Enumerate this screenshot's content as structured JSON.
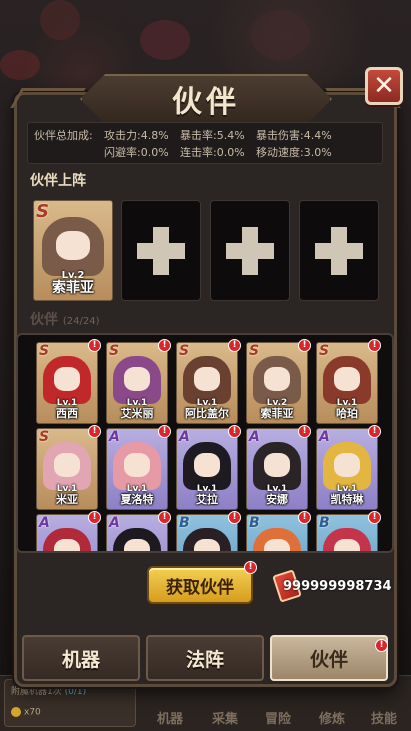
{
  "modal": {
    "title": "伙伴",
    "close_label": "✕"
  },
  "stats": {
    "label": "伙伴总加成:",
    "items": [
      "攻击力:4.8%",
      "暴击率:5.4%",
      "暴击伤害:4.4%",
      "闪避率:0.0%",
      "连击率:0.0%",
      "移动速度:3.0%"
    ]
  },
  "lineup": {
    "title": "伙伴上阵",
    "card": {
      "rarity": "S",
      "level": "Lv.2",
      "name": "索菲亚",
      "color": "#7a5a48"
    }
  },
  "roster": {
    "title": "伙伴",
    "count": "(24/24)",
    "cards": [
      {
        "rarity": "S",
        "level": "Lv.1",
        "name": "西西",
        "color": "#c0282a"
      },
      {
        "rarity": "S",
        "level": "Lv.1",
        "name": "艾米丽",
        "color": "#8a4a8a"
      },
      {
        "rarity": "S",
        "level": "Lv.1",
        "name": "阿比盖尔",
        "color": "#6a4030"
      },
      {
        "rarity": "S",
        "level": "Lv.2",
        "name": "索菲亚",
        "color": "#7a5a48"
      },
      {
        "rarity": "S",
        "level": "Lv.1",
        "name": "哈珀",
        "color": "#8a3a2a"
      },
      {
        "rarity": "S",
        "level": "Lv.1",
        "name": "米亚",
        "color": "#e2a6b2"
      },
      {
        "rarity": "A",
        "level": "Lv.1",
        "name": "夏洛特",
        "color": "#e59aa6"
      },
      {
        "rarity": "A",
        "level": "Lv.1",
        "name": "艾拉",
        "color": "#1e1a22"
      },
      {
        "rarity": "A",
        "level": "Lv.1",
        "name": "安娜",
        "color": "#2a2426"
      },
      {
        "rarity": "A",
        "level": "Lv.1",
        "name": "凯特琳",
        "color": "#e2b640"
      },
      {
        "rarity": "A",
        "level": "",
        "name": "",
        "color": "#b02a3a"
      },
      {
        "rarity": "A",
        "level": "",
        "name": "",
        "color": "#1c1a1e"
      },
      {
        "rarity": "B",
        "level": "",
        "name": "",
        "color": "#2a2024"
      },
      {
        "rarity": "B",
        "level": "",
        "name": "",
        "color": "#e0703a"
      },
      {
        "rarity": "B",
        "level": "",
        "name": "",
        "color": "#c4344a"
      }
    ]
  },
  "badge": "!",
  "get_button": "获取伙伴",
  "currency": "999999998734",
  "tabs": [
    "机器",
    "法阵",
    "伙伴"
  ],
  "game_nav": {
    "enchant_label": "附魔机器1次",
    "enchant_progress": "(0/1)",
    "enchant_reward": "x70",
    "items": [
      "机器",
      "采集",
      "冒险",
      "修炼",
      "技能"
    ]
  }
}
